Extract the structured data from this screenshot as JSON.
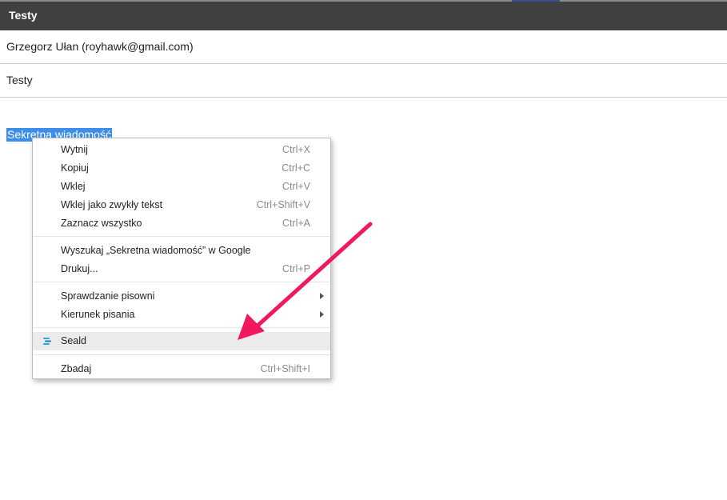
{
  "header": {
    "title": "Testy"
  },
  "email": {
    "from": "Grzegorz Ułan (royhawk@gmail.com)",
    "subject": "Testy",
    "body_selected_text": "Sekretna wiadomość"
  },
  "context_menu": {
    "items": [
      {
        "label": "Wytnij",
        "shortcut": "Ctrl+X"
      },
      {
        "label": "Kopiuj",
        "shortcut": "Ctrl+C"
      },
      {
        "label": "Wklej",
        "shortcut": "Ctrl+V"
      },
      {
        "label": "Wklej jako zwykły tekst",
        "shortcut": "Ctrl+Shift+V"
      },
      {
        "label": "Zaznacz wszystko",
        "shortcut": "Ctrl+A"
      },
      {
        "label": "Wyszukaj „Sekretna wiadomość” w Google",
        "shortcut": ""
      },
      {
        "label": "Drukuj...",
        "shortcut": "Ctrl+P"
      },
      {
        "label": "Sprawdzanie pisowni",
        "shortcut": ""
      },
      {
        "label": "Kierunek pisania",
        "shortcut": ""
      },
      {
        "label": "Seald",
        "shortcut": "",
        "icon": "seald-logo-icon"
      },
      {
        "label": "Zbadaj",
        "shortcut": "Ctrl+Shift+I"
      }
    ]
  },
  "colors": {
    "header_bg": "#404040",
    "selection_bg": "#3d8ee8",
    "arrow": "#f0195e",
    "seald_icon": "#2aa7e0"
  }
}
